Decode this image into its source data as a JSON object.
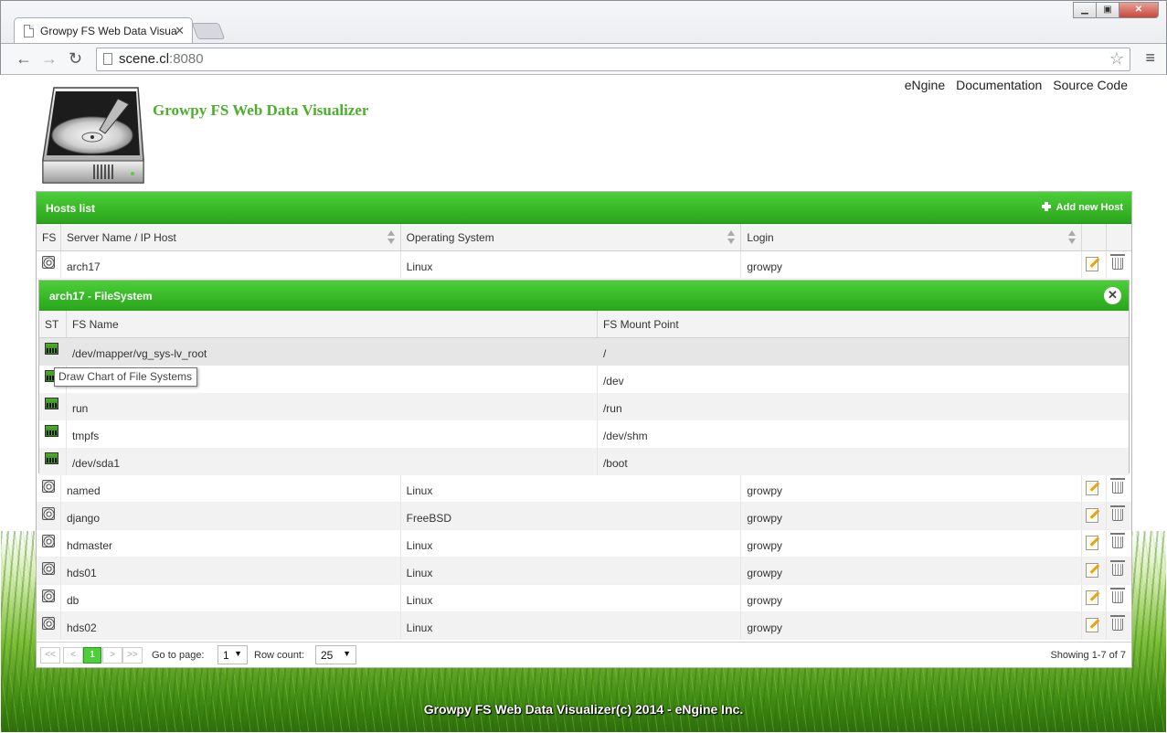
{
  "browser": {
    "tab_title": "Growpy FS Web Data Visua",
    "url_host": "scene.cl",
    "url_port": ":8080"
  },
  "site": {
    "title": "Growpy FS Web Data Visualizer",
    "nav": [
      "eNgine",
      "Documentation",
      "Source Code"
    ]
  },
  "hosts_grid": {
    "title": "Hosts list",
    "add_label": "Add new Host",
    "columns": [
      "FS",
      "Server Name / IP Host",
      "Operating System",
      "Login"
    ],
    "rows": [
      {
        "name": "arch17",
        "os": "Linux",
        "login": "growpy"
      },
      {
        "name": "named",
        "os": "Linux",
        "login": "growpy"
      },
      {
        "name": "django",
        "os": "FreeBSD",
        "login": "growpy"
      },
      {
        "name": "hdmaster",
        "os": "Linux",
        "login": "growpy"
      },
      {
        "name": "hds01",
        "os": "Linux",
        "login": "growpy"
      },
      {
        "name": "db",
        "os": "Linux",
        "login": "growpy"
      },
      {
        "name": "hds02",
        "os": "Linux",
        "login": "growpy"
      }
    ]
  },
  "fs_grid": {
    "title": "arch17 - FileSystem",
    "columns": [
      "ST",
      "FS Name",
      "FS Mount Point"
    ],
    "rows": [
      {
        "name": "/dev/mapper/vg_sys-lv_root",
        "mount": "/"
      },
      {
        "name": "",
        "mount": "/dev"
      },
      {
        "name": "run",
        "mount": "/run"
      },
      {
        "name": "tmpfs",
        "mount": "/dev/shm"
      },
      {
        "name": "/dev/sda1",
        "mount": "/boot"
      }
    ],
    "tooltip": "Draw Chart of File Systems"
  },
  "pager": {
    "first": "<<",
    "prev": "<",
    "current": "1",
    "next": ">",
    "last": ">>",
    "goto_label": "Go to page:",
    "goto_value": "1",
    "rowcount_label": "Row count:",
    "rowcount_value": "25",
    "showing": "Showing 1-7 of 7"
  },
  "footer": "Growpy FS Web Data Visualizer(c) 2014 - eNgine Inc."
}
